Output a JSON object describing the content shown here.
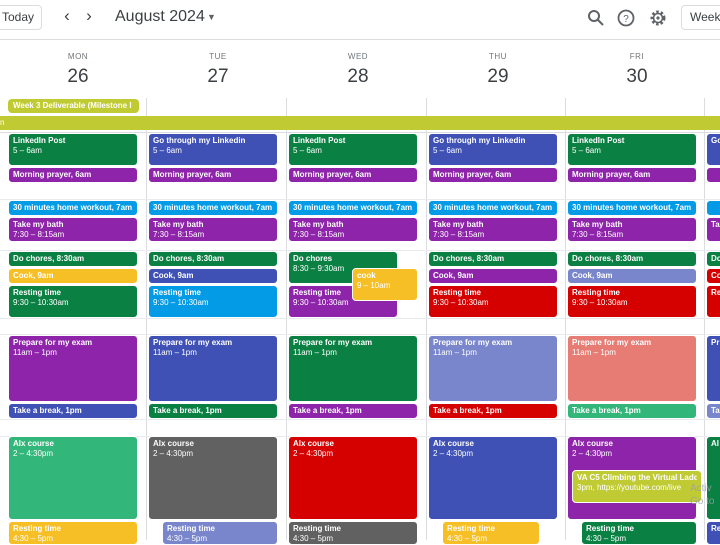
{
  "header": {
    "today_label": "Today",
    "prev_icon": "chevron-left-icon",
    "next_icon": "chevron-right-icon",
    "month_title": "August 2024",
    "view_label": "Week",
    "search_icon": "search-icon",
    "help_icon": "help-icon",
    "settings_icon": "gear-icon"
  },
  "days": [
    {
      "dow": "MON",
      "num": "26"
    },
    {
      "dow": "TUE",
      "num": "27"
    },
    {
      "dow": "WED",
      "num": "28"
    },
    {
      "dow": "THU",
      "num": "29"
    },
    {
      "dow": "FRI",
      "num": "30"
    }
  ],
  "allday": {
    "milestone": "Week 3 Deliverable (Milestone I",
    "multiday": "n"
  },
  "events": {
    "mon": {
      "e1": {
        "title": "LinkedIn Post",
        "sub": "5 – 6am"
      },
      "e2": {
        "title": "Morning prayer, 6am"
      },
      "e3": {
        "title": "30 minutes home workout, 7am"
      },
      "e4": {
        "title": "Take my bath",
        "sub": "7:30 – 8:15am"
      },
      "e5": {
        "title": "Do chores, 8:30am"
      },
      "e6": {
        "title": "Cook, 9am"
      },
      "e7": {
        "title": "Resting time",
        "sub": "9:30 – 10:30am"
      },
      "e8": {
        "title": "Prepare for my exam",
        "sub": "11am – 1pm"
      },
      "e9": {
        "title": "Take a break, 1pm"
      },
      "e10": {
        "title": "Alx course",
        "sub": "2 – 4:30pm"
      },
      "e11": {
        "title": "Resting time",
        "sub": "4:30 – 5pm"
      }
    },
    "tue": {
      "e1": {
        "title": "Go through my Linkedin",
        "sub": "5 – 6am"
      },
      "e2": {
        "title": "Morning prayer, 6am"
      },
      "e3": {
        "title": "30 minutes home workout, 7am"
      },
      "e4": {
        "title": "Take my bath",
        "sub": "7:30 – 8:15am"
      },
      "e5": {
        "title": "Do chores, 8:30am"
      },
      "e6": {
        "title": "Cook, 9am"
      },
      "e7": {
        "title": "Resting time",
        "sub": "9:30 – 10:30am"
      },
      "e8": {
        "title": "Prepare for my exam",
        "sub": "11am – 1pm"
      },
      "e9": {
        "title": "Take a break, 1pm"
      },
      "e10": {
        "title": "Alx course",
        "sub": "2 – 4:30pm"
      },
      "e11": {
        "title": "Resting time",
        "sub": "4:30 – 5pm"
      }
    },
    "wed": {
      "e1": {
        "title": "LinkedIn Post",
        "sub": "5 – 6am"
      },
      "e2": {
        "title": "Morning prayer, 6am"
      },
      "e3": {
        "title": "30 minutes home workout, 7am"
      },
      "e4": {
        "title": "Take my bath",
        "sub": "7:30 – 8:15am"
      },
      "e5": {
        "title": "Do chores",
        "sub": "8:30 – 9:30am"
      },
      "e6": {
        "title": "cook",
        "sub": "9 – 10am"
      },
      "e7": {
        "title": "Resting time",
        "sub": "9:30 – 10:30am"
      },
      "e8": {
        "title": "Prepare for my exam",
        "sub": "11am – 1pm"
      },
      "e9": {
        "title": "Take a break, 1pm"
      },
      "e10": {
        "title": "Alx course",
        "sub": "2 – 4:30pm"
      },
      "e11": {
        "title": "Resting time",
        "sub": "4:30 – 5pm"
      }
    },
    "thu": {
      "e1": {
        "title": "Go through my Linkedin",
        "sub": "5 – 6am"
      },
      "e2": {
        "title": "Morning prayer, 6am"
      },
      "e3": {
        "title": "30 minutes home workout, 7am"
      },
      "e4": {
        "title": "Take my bath",
        "sub": "7:30 – 8:15am"
      },
      "e5": {
        "title": "Do chores, 8:30am"
      },
      "e6": {
        "title": "Cook, 9am"
      },
      "e7": {
        "title": "Resting time",
        "sub": "9:30 – 10:30am"
      },
      "e8": {
        "title": "Prepare for my exam",
        "sub": "11am – 1pm"
      },
      "e9": {
        "title": "Take a break, 1pm"
      },
      "e10": {
        "title": "Alx course",
        "sub": "2 – 4:30pm"
      },
      "e11": {
        "title": "Resting time",
        "sub": "4:30 – 5pm"
      }
    },
    "fri": {
      "e1": {
        "title": "LinkedIn Post",
        "sub": "5 – 6am"
      },
      "e2": {
        "title": "Morning prayer, 6am"
      },
      "e3": {
        "title": "30 minutes home workout, 7am"
      },
      "e4": {
        "title": "Take my bath",
        "sub": "7:30 – 8:15am"
      },
      "e5": {
        "title": "Do chores, 8:30am"
      },
      "e6": {
        "title": "Cook, 9am"
      },
      "e7": {
        "title": "Resting time",
        "sub": "9:30 – 10:30am"
      },
      "e8": {
        "title": "Prepare for my exam",
        "sub": "11am – 1pm"
      },
      "e9": {
        "title": "Take a break, 1pm"
      },
      "e10": {
        "title": "Alx course",
        "sub": "2 – 4:30pm"
      },
      "e12": {
        "title": "VA C5 Climbing the Virtual Ladder",
        "sub": "3pm, https://youtube.com/live"
      },
      "e11": {
        "title": "Resting time",
        "sub": "4:30 – 5pm"
      }
    },
    "sat": {
      "c1": {
        "title": "Go"
      },
      "c2": {
        "title": "Ta"
      },
      "c3": {
        "title": "Do"
      },
      "c4": {
        "title": "Co"
      },
      "c5": {
        "title": "Re"
      },
      "c6": {
        "title": "Pr"
      },
      "c7": {
        "title": "Ta"
      },
      "c8": {
        "title": "Al"
      },
      "c9": {
        "title": "Re"
      }
    }
  },
  "watermark": {
    "line1": "Activ",
    "line2": "Go to"
  }
}
